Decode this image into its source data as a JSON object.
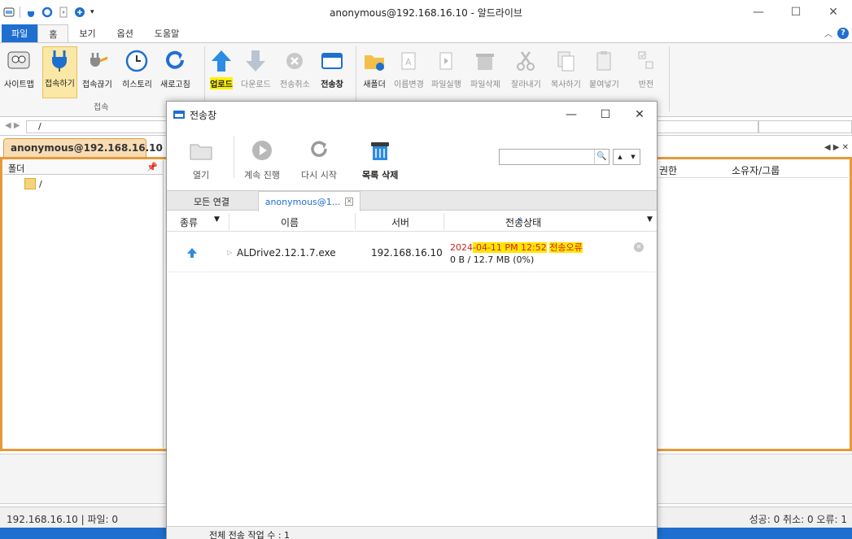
{
  "window": {
    "title": "anonymous@192.168.16.10 - 알드라이브",
    "min": "—",
    "max": "☐",
    "close": "✕"
  },
  "ribbon_tabs": [
    "파일",
    "홈",
    "보기",
    "옵션",
    "도움말"
  ],
  "ribbon": {
    "connect": [
      "사이트맵",
      "접속하기",
      "접속끊기",
      "히스토리",
      "새로고침"
    ],
    "connect_group": "접속",
    "transfer": [
      "업로드",
      "다운로드",
      "전송취소",
      "전송창"
    ],
    "edit": [
      "새폴더",
      "이름변경",
      "파일실행",
      "파일삭제",
      "잘라내기",
      "복사하기",
      "붙여넣기",
      "반전"
    ]
  },
  "address": {
    "path": "/"
  },
  "site_tab": "anonymous@192.168.16.10",
  "folder_pane": {
    "header": "폴더",
    "root": "/"
  },
  "columns_right": {
    "permission": "권한",
    "owner": "소유자/그룹"
  },
  "status": {
    "left": "192.168.16.10 | 파일: 0",
    "right": "성공: 0 취소: 0 오류: 1"
  },
  "dialog": {
    "title": "전송창",
    "toolbar": [
      "열기",
      "계속 진행",
      "다시 시작",
      "목록 삭제"
    ],
    "tabs": {
      "all": "모든 연결",
      "session": "anonymous@1..."
    },
    "headers": {
      "type": "종류",
      "name": "이름",
      "server": "서버",
      "status": "전송상태"
    },
    "row": {
      "name": "ALDrive2.12.1.7.exe",
      "server": "192.168.16.10",
      "date_prefix": "2024",
      "date_rest": "-04-11 PM 12:52",
      "error": "전송오류",
      "progress": "0 B / 12.7 MB (0%)"
    },
    "footer": "전체 전송 작업 수 : 1"
  },
  "colors": {
    "accent": "#1e6fd0",
    "frame": "#e59a3a",
    "highlight": "#ffe600",
    "error": "#d02020"
  }
}
